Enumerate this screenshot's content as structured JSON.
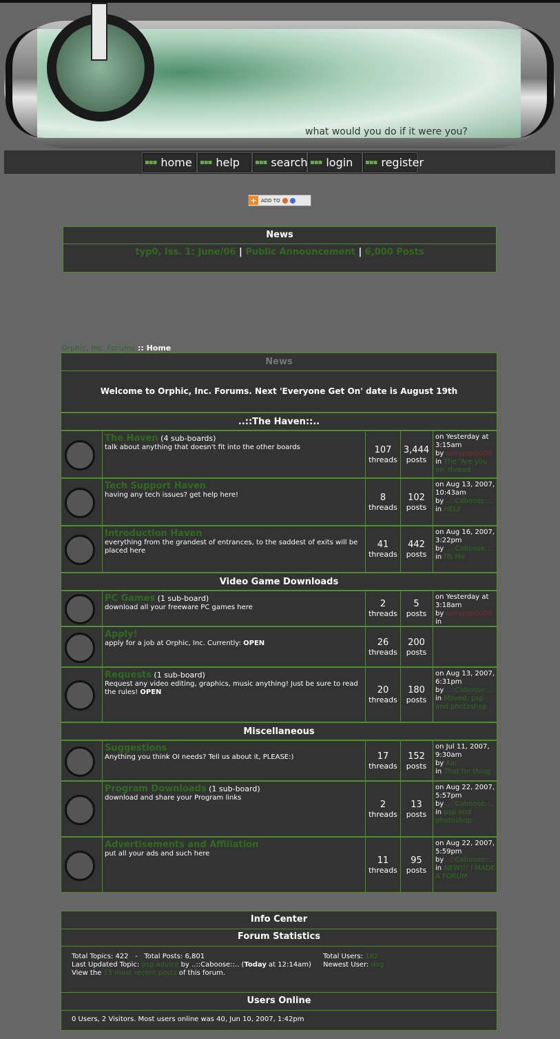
{
  "banner": {
    "tagline": "what would you do if it were you?"
  },
  "nav": [
    "home",
    "help",
    "search",
    "login",
    "register"
  ],
  "addto": {
    "label": "ADD TO"
  },
  "news_box": {
    "title": "News",
    "links": [
      "typ0, Iss. 1: June/06",
      "Public Announcement",
      "6,000 Posts"
    ]
  },
  "breadcrumb": {
    "forum": "Orphic, Inc. Forums",
    "sep": " :: ",
    "current": "Home"
  },
  "board_news": {
    "title": "News",
    "message": "Welcome to Orphic, Inc. Forums. Next 'Everyone Get On' date is August 19th"
  },
  "categories": [
    {
      "name": "..::The Haven::..",
      "boards": [
        {
          "title": "The Haven",
          "sub": "(4 sub-boards)",
          "desc": "talk about anything that doesn't fit into the other boards",
          "threads": "107",
          "posts": "3,444",
          "last": {
            "when": "on Yesterday at 3:15am",
            "by": "by",
            "user": "sonypsp0009",
            "in": "in",
            "topic": "The 'Are you on' thread"
          }
        },
        {
          "title": "Tech Support Haven",
          "sub": "",
          "desc": "having any tech issues? get help here!",
          "threads": "8",
          "posts": "102",
          "last": {
            "when": "on Aug 13, 2007, 10:43am",
            "by": "by",
            "user": "..::Caboose::..",
            "in": "in",
            "topic": "HELP"
          }
        },
        {
          "title": "Introduction Haven",
          "sub": "",
          "desc": "everything from the grandest of entrances, to the saddest of exits will be placed here",
          "threads": "41",
          "posts": "442",
          "last": {
            "when": "on Aug 16, 2007, 3:22pm",
            "by": "by",
            "user": "..::Caboose::..",
            "in": "in",
            "topic": "ITs Me"
          }
        }
      ]
    },
    {
      "name": "Video Game Downloads",
      "boards": [
        {
          "title": "PC Games",
          "sub": "(1 sub-board)",
          "desc": "download all your freeware PC games here",
          "threads": "2",
          "posts": "5",
          "last": {
            "when": "on Yesterday at 3:18am",
            "by": "by",
            "user": "sonypsp0009",
            "in": "in",
            "topic": ""
          }
        },
        {
          "title": "Apply!",
          "sub": "",
          "desc": "apply for a job at Orphic, Inc. Currently:",
          "desc_bold": "OPEN",
          "threads": "26",
          "posts": "200",
          "last": {
            "when": "",
            "by": "",
            "user": "",
            "in": "",
            "topic": ""
          }
        },
        {
          "title": "Requests",
          "sub": "(1 sub-board)",
          "desc": "Request any video editing, graphics, music anything! Just be sure to read the rules!",
          "desc_bold": "OPEN",
          "threads": "20",
          "posts": "180",
          "last": {
            "when": "on Aug 13, 2007, 6:31pm",
            "by": "by",
            "user": "..::Caboose::..",
            "in": "in",
            "topic": "Moved: psp and photoshop"
          }
        }
      ]
    },
    {
      "name": "Miscellaneous",
      "boards": [
        {
          "title": "Suggestions",
          "sub": "",
          "desc": "Anything you think OI needs? Tell us about it, PLEASE:)",
          "threads": "17",
          "posts": "152",
          "last": {
            "when": "on Jul 11, 2007, 9:30am",
            "by": "by",
            "user": "Kai",
            "in": "in",
            "topic": "That fm thing"
          }
        },
        {
          "title": "Program Downloads",
          "sub": "(1 sub-board)",
          "desc": "download and share your Program links",
          "threads": "2",
          "posts": "13",
          "last": {
            "when": "on Aug 22, 2007, 5:57pm",
            "by": "by",
            "user": "..::Caboose::..",
            "in": "in",
            "topic": "psp and photoshop"
          }
        },
        {
          "title": "Advertisements and Affiliation",
          "sub": "",
          "desc": "put all your ads and such here",
          "threads": "11",
          "posts": "95",
          "last": {
            "when": "on Aug 22, 2007, 5:59pm",
            "by": "by",
            "user": "..::Caboose::..",
            "in": "in",
            "topic": "NEW!!! I MADE A FORUM"
          }
        }
      ]
    }
  ],
  "labels": {
    "threads": "threads",
    "posts": "posts"
  },
  "info_center": {
    "title": "Info Center",
    "stats_title": "Forum Statistics",
    "total_topics": "Total Topics: 422",
    "dash": "-",
    "total_posts": "Total Posts: 6,801",
    "last_updated_prefix": "Last Updated Topic:",
    "last_topic": "psp advice",
    "by": "by",
    "last_user": "..::Caboose::..",
    "today": "Today",
    "at": "at 12:14am)",
    "view_prefix": "View the",
    "recent_link": "15 most recent posts",
    "view_suffix": "of this forum.",
    "total_users_label": "Total Users:",
    "total_users": "182",
    "newest_label": "Newest User:",
    "newest_user": "dog",
    "online_title": "Users Online",
    "online_text": "0 Users, 2 Visitors. Most users online was 40, Jun 10, 2007, 1:42pm"
  }
}
